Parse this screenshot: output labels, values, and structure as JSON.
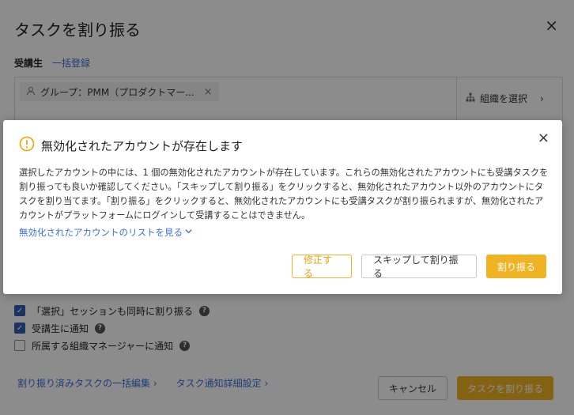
{
  "background_dialog": {
    "title": "タスクを割り振る",
    "close_glyph": "×",
    "learners_label": "受講生",
    "bulk_register_link": "一括登録",
    "chip": {
      "icon": "user-icon",
      "label": "グループ：PMM（プロダクトマー...",
      "remove_glyph": "×"
    },
    "org_select": {
      "icon": "org-tree-icon",
      "label": "組織を選択",
      "chevron": "›"
    },
    "options": [
      {
        "label": "「選択」セッションも同時に割り振る",
        "checked": true,
        "help": true
      },
      {
        "label": "受講生に通知",
        "checked": true,
        "help": true
      },
      {
        "label": "所属する組織マネージャーに通知",
        "checked": false,
        "help": true
      }
    ],
    "footer_links": [
      "割り振り済みタスクの一括編集 ›",
      "タスク通知詳細設定 ›"
    ],
    "cancel_button": "キャンセル",
    "assign_button": "タスクを割り振る"
  },
  "warning_modal": {
    "icon": "warning-circle-icon",
    "title": "無効化されたアカウントが存在します",
    "close_glyph": "×",
    "body": "選択したアカウントの中には、1 個の無効化されたアカウントが存在しています。これらの無効化されたアカウントにも受講タスクを割り振っても良いか確認してください。「スキップして割り振る」をクリックすると、無効化されたアカウント以外のアカウントにタスクを割り当てます。「割り振る」をクリックすると、無効化されたアカウントにも受講タスクが割り振られますが、無効化されたアカウントがプラットフォームにログインして受講することはできません。",
    "list_link": "無効化されたアカウントのリストを見る",
    "buttons": {
      "fix": "修正する",
      "skip": "スキップして割り振る",
      "assign": "割り振る"
    }
  },
  "colors": {
    "accent": "#f0b323",
    "link": "#3b6fd9",
    "checkbox": "#2f5fb5",
    "overlay": "rgba(0,0,0,0.45)"
  }
}
